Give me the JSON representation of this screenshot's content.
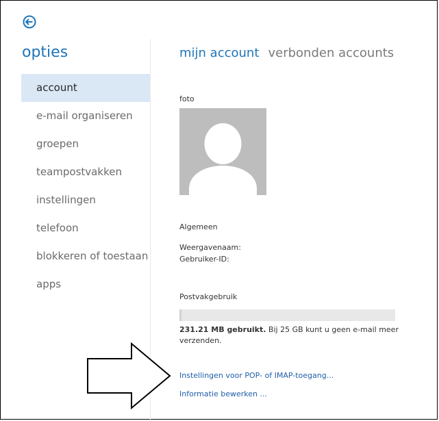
{
  "sidebar": {
    "title": "opties",
    "items": [
      {
        "label": "account",
        "active": true
      },
      {
        "label": "e-mail organiseren",
        "active": false
      },
      {
        "label": "groepen",
        "active": false
      },
      {
        "label": "teampostvakken",
        "active": false
      },
      {
        "label": "instellingen",
        "active": false
      },
      {
        "label": "telefoon",
        "active": false
      },
      {
        "label": "blokkeren of toestaan",
        "active": false
      },
      {
        "label": "apps",
        "active": false
      }
    ]
  },
  "tabs": [
    {
      "label": "mijn account",
      "active": true
    },
    {
      "label": "verbonden accounts",
      "active": false
    }
  ],
  "account": {
    "photo_label": "foto",
    "general_heading": "Algemeen",
    "display_name_label": "Weergavenaam:",
    "user_id_label": "Gebruiker-ID:",
    "mailbox_usage_heading": "Postvakgebruik",
    "usage_bold": "231.21 MB gebruikt.",
    "usage_rest": " Bij 25 GB kunt u geen e-mail meer verzenden.",
    "usage_fraction": 0.009
  },
  "links": {
    "pop_imap": "Instellingen voor POP- of IMAP-toegang...",
    "edit_info": "Informatie bewerken ..."
  },
  "icons": {
    "back": "back-arrow-icon",
    "pointer": "arrow-pointer-icon"
  },
  "colors": {
    "accent": "#1f75b8",
    "active_bg": "#dae8f6",
    "link": "#1f5ea8"
  }
}
